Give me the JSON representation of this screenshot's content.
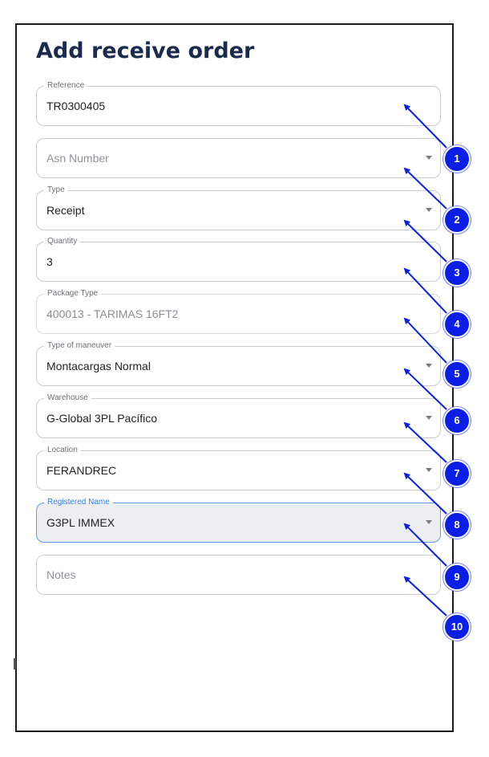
{
  "form": {
    "title": "Add receive order",
    "fields": [
      {
        "label": "Reference",
        "value": "TR0300405",
        "placeholder": "",
        "dropdown": false,
        "state": "normal"
      },
      {
        "label": "",
        "value": "",
        "placeholder": "Asn Number",
        "dropdown": true,
        "state": "normal"
      },
      {
        "label": "Type",
        "value": "Receipt",
        "placeholder": "",
        "dropdown": true,
        "state": "normal"
      },
      {
        "label": "Quantity",
        "value": "3",
        "placeholder": "",
        "dropdown": false,
        "state": "normal"
      },
      {
        "label": "Package Type",
        "value": "400013 - TARIMAS 16FT2",
        "placeholder": "",
        "dropdown": false,
        "state": "disabled"
      },
      {
        "label": "Type of maneuver",
        "value": "Montacargas Normal",
        "placeholder": "",
        "dropdown": true,
        "state": "normal"
      },
      {
        "label": "Warehouse",
        "value": "G-Global 3PL Pacífico",
        "placeholder": "",
        "dropdown": true,
        "state": "normal"
      },
      {
        "label": "Location",
        "value": "FERANDREC",
        "placeholder": "",
        "dropdown": true,
        "state": "normal"
      },
      {
        "label": "Registered Name",
        "value": "G3PL IMMEX",
        "placeholder": "",
        "dropdown": true,
        "state": "focused"
      },
      {
        "label": "",
        "value": "",
        "placeholder": "Notes",
        "dropdown": false,
        "state": "normal"
      }
    ]
  },
  "annotations": {
    "badges": [
      "1",
      "2",
      "3",
      "4",
      "5",
      "6",
      "7",
      "8",
      "9",
      "10"
    ],
    "color": "#0a1ee6"
  }
}
